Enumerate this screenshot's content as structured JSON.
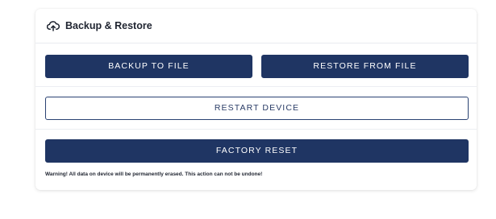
{
  "card": {
    "title": "Backup & Restore",
    "icon": "cloud-upload-icon"
  },
  "buttons": {
    "backup": "BACKUP TO FILE",
    "restore": "RESTORE FROM FILE",
    "restart": "RESTART DEVICE",
    "factory_reset": "FACTORY RESET"
  },
  "warning": "Warning! All data on device will be permanently erased. This action can not be undone!",
  "colors": {
    "primary": "#1f3563",
    "outline": "#2a4272",
    "text": "#1f2430"
  }
}
